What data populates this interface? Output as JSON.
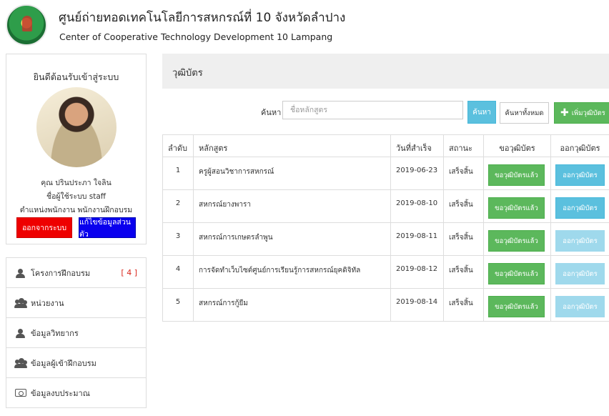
{
  "header": {
    "title_th": "ศูนย์ถ่ายทอดเทคโนโลยีการสหกรณ์ที่ 10 จังหวัดลำปาง",
    "title_en": "Center of Cooperative Technology Development 10 Lampang"
  },
  "profile": {
    "welcome": "ยินดีต้อนรับเข้าสู่ระบบ",
    "name": "คุณ ปรินประภา ใจลิน",
    "username": "ชื่อผู้ใช้ระบบ staff",
    "position": "ตำแหน่งพนักงาน พนักงานฝึกอบรม",
    "logout_label": "ออกจากระบบ",
    "edit_label": "แก้ไขข้อมูลส่วนตัว"
  },
  "menu": {
    "items": [
      {
        "label": "โครงการฝึกอบรม",
        "badge": "[ 4 ]",
        "icon": "user-icon"
      },
      {
        "label": "หน่วยงาน",
        "icon": "users-icon"
      },
      {
        "label": "ข้อมูลวิทยากร",
        "icon": "user-icon"
      },
      {
        "label": "ข้อมูลผู้เข้าฝึกอบรม",
        "icon": "users-icon"
      },
      {
        "label": "ข้อมูลงบประมาณ",
        "icon": "money-icon"
      }
    ]
  },
  "panel": {
    "title": "วุฒิบัตร"
  },
  "search": {
    "label": "ค้นหา",
    "placeholder": "ชื่อหลักสูตร",
    "value": "",
    "search_button": "ค้นหา",
    "show_all_button": "ค้นหาทั้งหมด",
    "add_button": "เพิ่มวุฒิบัตร"
  },
  "table": {
    "headers": [
      "ลำดับ",
      "หลักสูตร",
      "วันที่สำเร็จ",
      "สถานะ",
      "ขอวุฒิบัตร",
      "ออกวุฒิบัตร"
    ],
    "rows": [
      {
        "no": "1",
        "course": "ครูผู้สอนวิชาการสหกรณ์",
        "date": "2019-06-23",
        "status": "เสร็จสิ้น",
        "request": "ขอวุฒิบัตรแล้ว",
        "issue": "ออกวุฒิบัตร",
        "issue_enabled": true
      },
      {
        "no": "2",
        "course": "สหกรณ์ยางพารา",
        "date": "2019-08-10",
        "status": "เสร็จสิ้น",
        "request": "ขอวุฒิบัตรแล้ว",
        "issue": "ออกวุฒิบัตร",
        "issue_enabled": true
      },
      {
        "no": "3",
        "course": "สหกรณ์การเกษตรลำพูน",
        "date": "2019-08-11",
        "status": "เสร็จสิ้น",
        "request": "ขอวุฒิบัตรแล้ว",
        "issue": "ออกวุฒิบัตร",
        "issue_enabled": false
      },
      {
        "no": "4",
        "course": "การจัดทำเว็บไซต์ศูนย์การเรียนรู้การสหกรณ์ยุคดิจิทัล",
        "date": "2019-08-12",
        "status": "เสร็จสิ้น",
        "request": "ขอวุฒิบัตรแล้ว",
        "issue": "ออกวุฒิบัตร",
        "issue_enabled": false
      },
      {
        "no": "5",
        "course": "สหกรณ์การกู้ยืม",
        "date": "2019-08-14",
        "status": "เสร็จสิ้น",
        "request": "ขอวุฒิบัตรแล้ว",
        "issue": "ออกวุฒิบัตร",
        "issue_enabled": false
      }
    ]
  },
  "colors": {
    "logout": "#ee0000",
    "edit": "#0a00ee",
    "success": "#5cb85c",
    "info": "#5bc0de",
    "info_disabled": "#9fd9ec",
    "badge": "#d9261c"
  }
}
